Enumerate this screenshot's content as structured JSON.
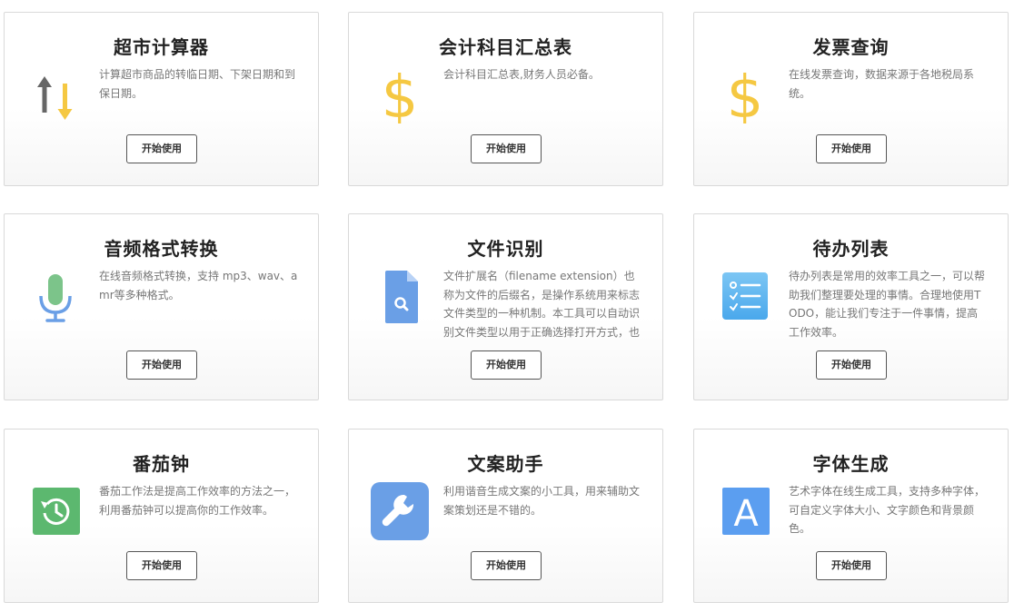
{
  "cards": [
    {
      "title": "超市计算器",
      "description": "计算超市商品的转临日期、下架日期和到保日期。",
      "icon": "up-down-arrows-icon",
      "button": "开始使用"
    },
    {
      "title": "会计科目汇总表",
      "description": "会计科目汇总表,财务人员必备。",
      "icon": "dollar-icon",
      "button": "开始使用"
    },
    {
      "title": "发票查询",
      "description": "在线发票查询，数据来源于各地税局系统。",
      "icon": "dollar-icon",
      "button": "开始使用"
    },
    {
      "title": "音频格式转换",
      "description": "在线音频格式转换，支持 mp3、wav、amr等多种格式。",
      "icon": "microphone-icon",
      "button": "开始使用"
    },
    {
      "title": "文件识别",
      "description": "文件扩展名（filename extension）也称为文件的后缀名，是操作系统用来标志文件类型的一种机制。本工具可以自动识别文件类型以用于正确选择打开方式，也可",
      "icon": "file-search-icon",
      "button": "开始使用"
    },
    {
      "title": "待办列表",
      "description": "待办列表是常用的效率工具之一，可以帮助我们整理要处理的事情。合理地使用TODO，能让我们专注于一件事情，提高工作效率。",
      "icon": "checklist-icon",
      "button": "开始使用"
    },
    {
      "title": "番茄钟",
      "description": "番茄工作法是提高工作效率的方法之一，利用番茄钟可以提高你的工作效率。",
      "icon": "history-clock-icon",
      "button": "开始使用"
    },
    {
      "title": "文案助手",
      "description": "利用谐音生成文案的小工具，用来辅助文案策划还是不错的。",
      "icon": "wrench-icon",
      "button": "开始使用"
    },
    {
      "title": "字体生成",
      "description": "艺术字体在线生成工具，支持多种字体，可自定义字体大小、文字颜色和背景颜色。",
      "icon": "letter-a-icon",
      "button": "开始使用"
    }
  ],
  "colors": {
    "dollar": "#f5c842",
    "arrow_up": "#666666",
    "arrow_down": "#f5c842",
    "microphone": "#7cc48a",
    "microphone_stand": "#6a9fe6",
    "file": "#6a9fe6",
    "checklist": "#5bb0ee",
    "history": "#5cb86f",
    "wrench_bg": "#6a9fe6",
    "letter_a_bg": "#5b9ef0"
  }
}
